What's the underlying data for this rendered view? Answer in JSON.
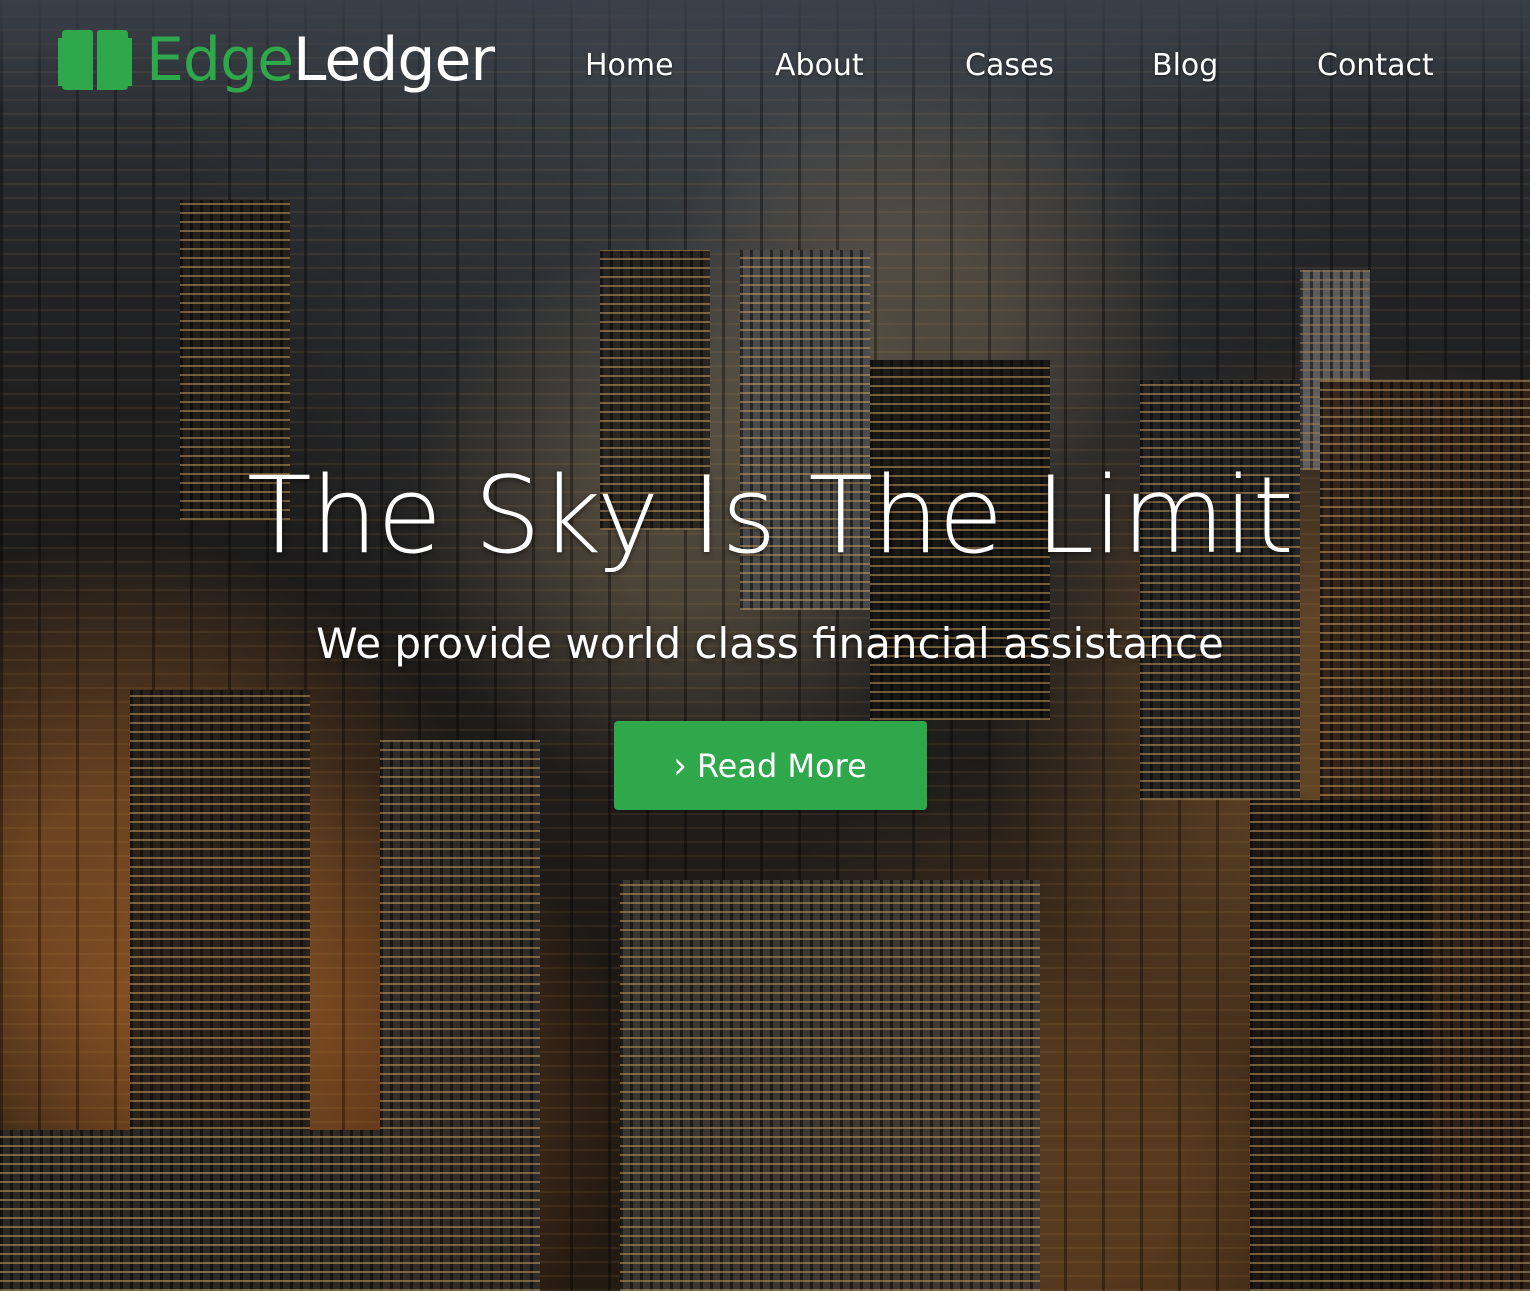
{
  "brand": {
    "name_part1": "Edge",
    "name_part2": "Ledger",
    "icon": "open-book-icon",
    "accent_color": "#2ea84a"
  },
  "nav": {
    "items": [
      {
        "label": "Home"
      },
      {
        "label": "About"
      },
      {
        "label": "Cases"
      },
      {
        "label": "Blog"
      },
      {
        "label": "Contact"
      }
    ]
  },
  "hero": {
    "headline": "The Sky Is The Limit",
    "subheadline": "We provide world class financial assistance",
    "cta": {
      "label": "Read More",
      "icon": "chevron-right-icon",
      "color": "#2ea84a"
    },
    "background": "night-city-aerial-photo"
  }
}
